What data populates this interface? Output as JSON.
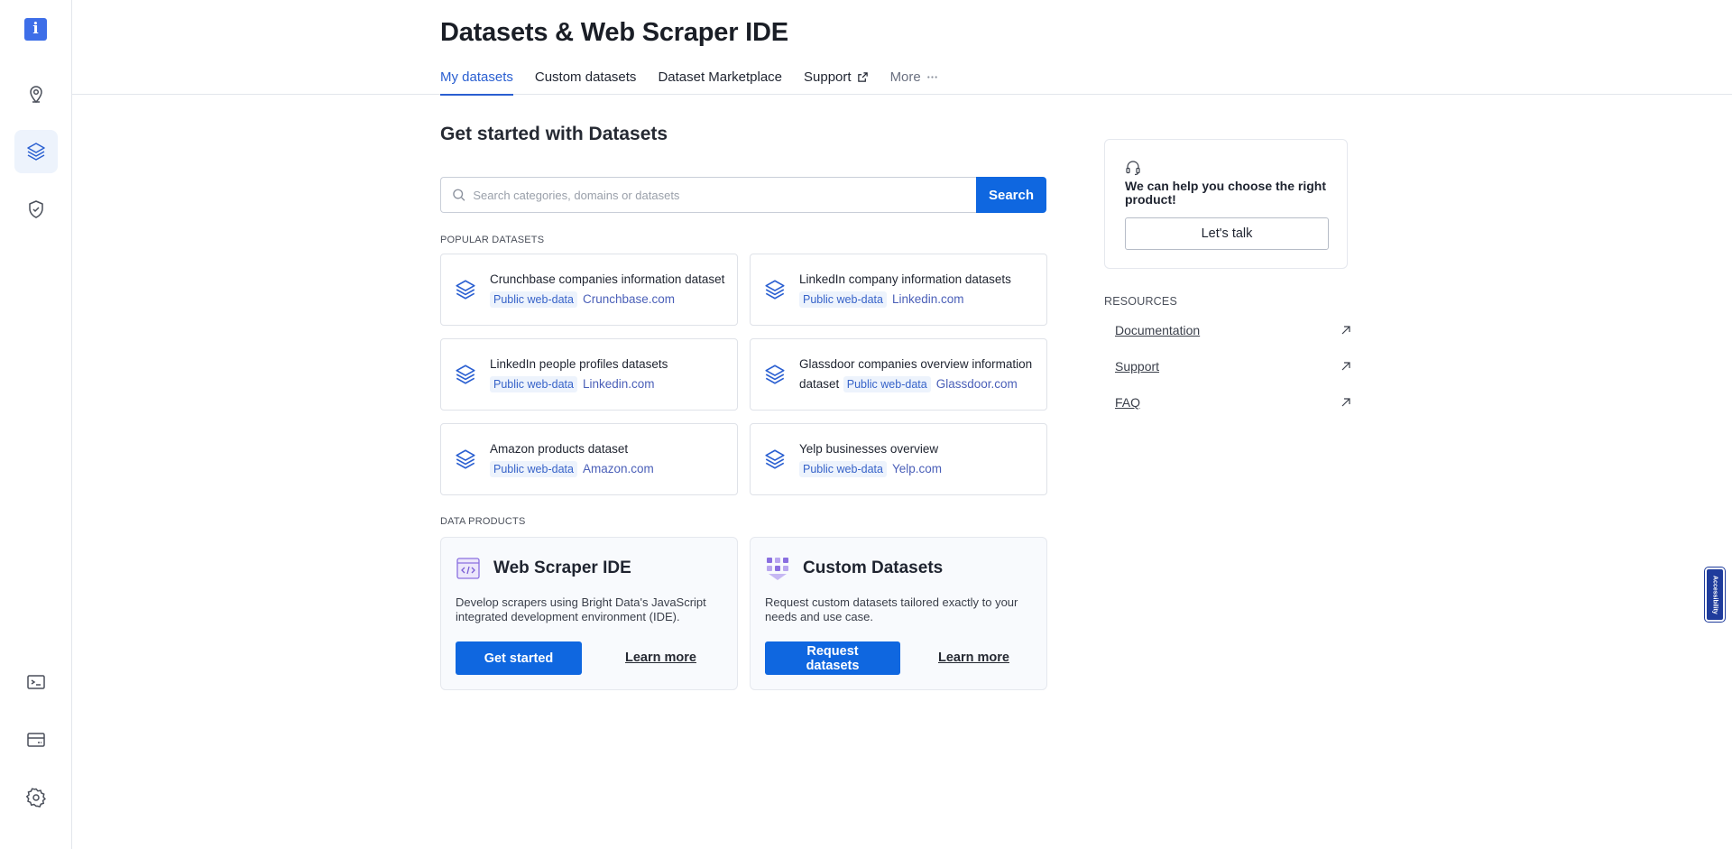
{
  "sidebar": {
    "logo_glyph": "i",
    "items": [
      {
        "name": "proxies",
        "icon": "location-pin-icon"
      },
      {
        "name": "datasets",
        "icon": "layers-icon",
        "active": true
      },
      {
        "name": "security",
        "icon": "shield-check-icon"
      },
      {
        "name": "terminal",
        "icon": "terminal-icon"
      },
      {
        "name": "billing",
        "icon": "credit-card-icon"
      },
      {
        "name": "settings",
        "icon": "gear-icon"
      }
    ]
  },
  "header": {
    "title": "Datasets & Web Scraper IDE",
    "tabs": [
      {
        "label": "My datasets",
        "active": true
      },
      {
        "label": "Custom datasets"
      },
      {
        "label": "Dataset Marketplace"
      },
      {
        "label": "Support",
        "icon": "external-link-icon"
      },
      {
        "label": "More",
        "icon": "ellipsis-icon"
      }
    ]
  },
  "main": {
    "section_title": "Get started with Datasets",
    "search": {
      "placeholder": "Search categories, domains or datasets",
      "value": "",
      "button_label": "Search"
    },
    "popular_label": "POPULAR DATASETS",
    "popular_datasets": [
      {
        "name": "Crunchbase companies information dataset",
        "tag": "Public web-data",
        "domain": "Crunchbase.com"
      },
      {
        "name": "LinkedIn company information datasets",
        "tag": "Public web-data",
        "domain": "Linkedin.com"
      },
      {
        "name": "LinkedIn people profiles datasets",
        "tag": "Public web-data",
        "domain": "Linkedin.com"
      },
      {
        "name": "Glassdoor companies overview information dataset",
        "tag": "Public web-data",
        "domain": "Glassdoor.com"
      },
      {
        "name": "Amazon products dataset",
        "tag": "Public web-data",
        "domain": "Amazon.com"
      },
      {
        "name": "Yelp businesses overview",
        "tag": "Public web-data",
        "domain": "Yelp.com"
      }
    ],
    "data_products_label": "DATA PRODUCTS",
    "data_products": [
      {
        "title": "Web Scraper IDE",
        "description": "Develop scrapers using Bright Data's JavaScript integrated development environment (IDE).",
        "primary_label": "Get started",
        "secondary_label": "Learn more"
      },
      {
        "title": "Custom Datasets",
        "description": "Request custom datasets tailored exactly to your needs and use case.",
        "primary_label": "Request datasets",
        "secondary_label": "Learn more"
      }
    ]
  },
  "right_panel": {
    "help_text": "We can help you choose the right product!",
    "help_button": "Let's talk",
    "resources_label": "RESOURCES",
    "resources": [
      {
        "label": "Documentation"
      },
      {
        "label": "Support"
      },
      {
        "label": "FAQ"
      }
    ]
  },
  "accessibility_label": "Accessibility",
  "colors": {
    "primary": "#0f67e0",
    "accent": "#2a5fd1",
    "tag_bg": "#edf3fc",
    "sidebar_logo": "#3d6ee8"
  }
}
